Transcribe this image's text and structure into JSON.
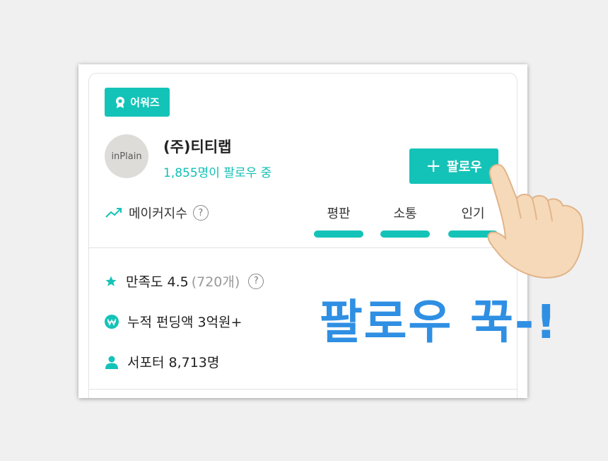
{
  "card": {
    "badge_label": "어워즈",
    "avatar_text": "inPlain",
    "company_name": "(주)티티랩",
    "follower_text": "1,855명이 팔로우 중",
    "follow_button_label": "팔로우"
  },
  "maker_index": {
    "label": "메이커지수",
    "help_symbol": "?",
    "metrics": [
      "평판",
      "소통",
      "인기"
    ]
  },
  "stats": {
    "satisfaction_label": "만족도 4.5",
    "satisfaction_count": "(720개)",
    "funding": "누적 펀딩액 3억원+",
    "supporters": "서포터 8,713명"
  },
  "overlay": {
    "text": "팔로우 꾹-!",
    "color": "#2f8fe3"
  },
  "colors": {
    "accent": "#14c3b8",
    "background": "#f0f0f0"
  }
}
